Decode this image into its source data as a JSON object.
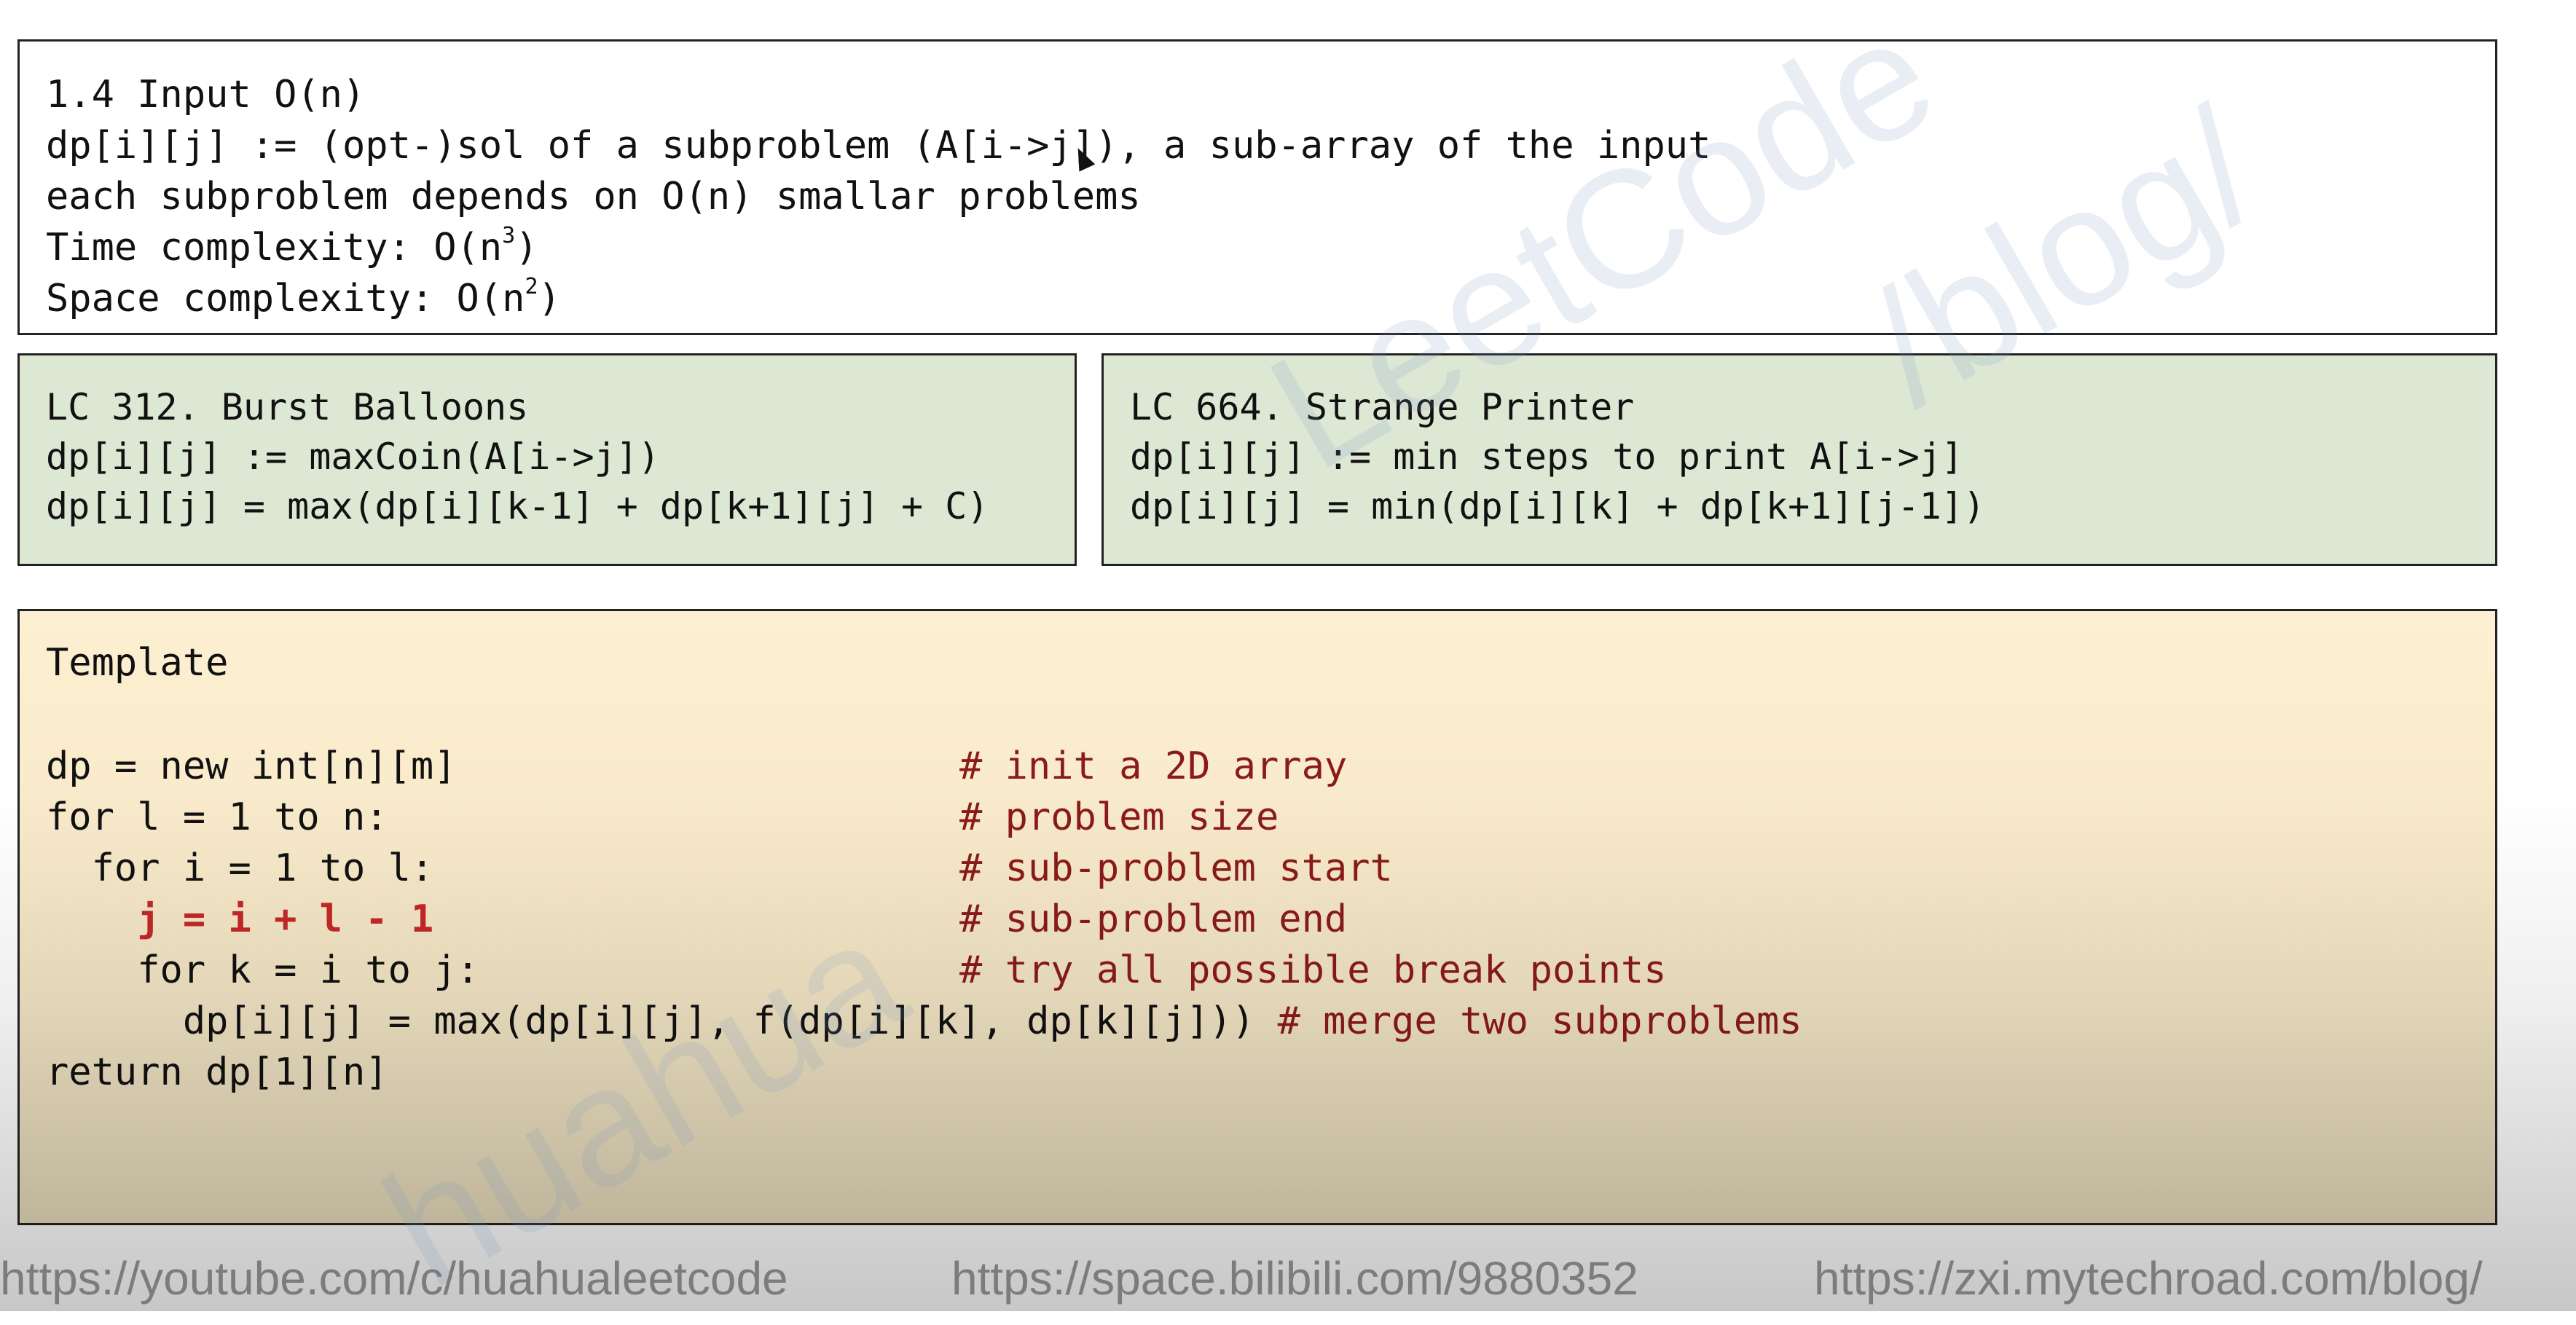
{
  "intro": {
    "lines": [
      "1.4 Input O(n)",
      "dp[i][j] := (opt-)sol of a subproblem (A[i->j]), a sub-array of the input",
      "each subproblem depends on O(n) smallar problems"
    ],
    "time_prefix": "Time complexity: O(n",
    "time_exp": "3",
    "time_suffix": ")",
    "space_prefix": "Space complexity: O(n",
    "space_exp": "2",
    "space_suffix": ")"
  },
  "lc312": {
    "title": "LC 312. Burst Balloons",
    "def": "dp[i][j] := maxCoin(A[i->j])",
    "rec": "dp[i][j] = max(dp[i][k-1] + dp[k+1][j] + C)"
  },
  "lc664": {
    "title": "LC 664. Strange Printer",
    "def": "dp[i][j] := min steps to print A[i->j]",
    "rec": "dp[i][j] = min(dp[i][k] + dp[k+1][j-1])"
  },
  "template": {
    "title": "Template",
    "code": [
      {
        "text": "dp = new int[n][m]",
        "comment": "# init a 2D array"
      },
      {
        "text": "for l = 1 to n:",
        "comment": "# problem size"
      },
      {
        "text": "  for i = 1 to l:",
        "comment": "# sub-problem start"
      },
      {
        "text": "    j = i + l - 1",
        "comment": "# sub-problem end"
      },
      {
        "text": "    for k = i to j:",
        "comment": "# try all possible break points"
      }
    ],
    "merge_line": "      dp[i][j] = max(dp[i][j], f(dp[i][k], dp[k][j]))",
    "merge_comment": " # merge two subproblems",
    "return_line": "return dp[1][n]"
  },
  "footer": {
    "youtube": "https://youtube.com/c/huahualeetcode",
    "bilibili": "https://space.bilibili.com/9880352",
    "blog": "https://zxi.mytechroad.com/blog/"
  },
  "watermark": [
    "LeetCode",
    "/blog/",
    "huahua"
  ],
  "colors": {
    "green_box": "#dde8d4",
    "template_bg": "#fdf0d2",
    "comment": "#8b1a1a",
    "highlight": "#c62828"
  }
}
